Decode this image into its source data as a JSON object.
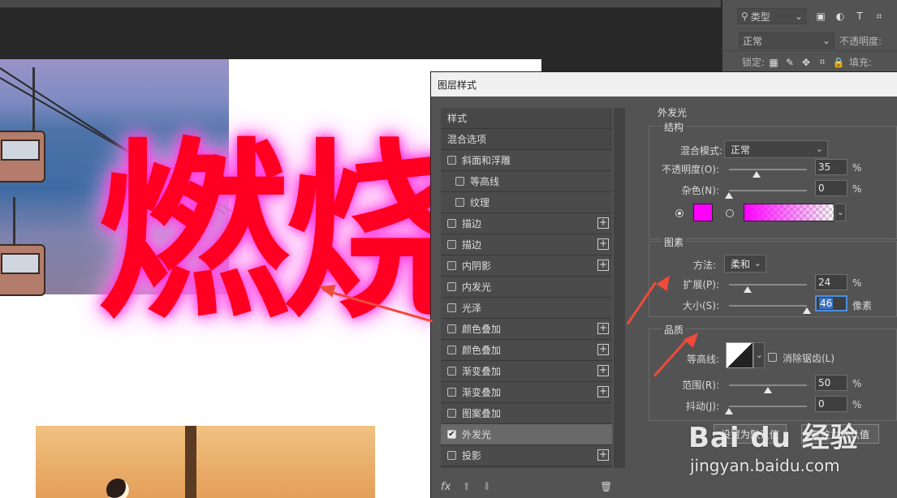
{
  "canvas": {
    "text_art": "燃烧"
  },
  "layers_panel": {
    "filter_label": "类型",
    "blend_mode": "正常",
    "opacity_label": "不透明度:",
    "lock_label": "锁定:",
    "fill_label": "填充:"
  },
  "dialog": {
    "title": "图层样式",
    "styles": [
      {
        "label": "样式",
        "type": "header"
      },
      {
        "label": "混合选项",
        "type": "header"
      },
      {
        "label": "斜面和浮雕",
        "checked": false,
        "plus": false,
        "indent": false
      },
      {
        "label": "等高线",
        "checked": false,
        "plus": false,
        "indent": true
      },
      {
        "label": "纹理",
        "checked": false,
        "plus": false,
        "indent": true
      },
      {
        "label": "描边",
        "checked": false,
        "plus": true,
        "indent": false
      },
      {
        "label": "描边",
        "checked": false,
        "plus": true,
        "indent": false
      },
      {
        "label": "内阴影",
        "checked": false,
        "plus": true,
        "indent": false
      },
      {
        "label": "内发光",
        "checked": false,
        "plus": false,
        "indent": false
      },
      {
        "label": "光泽",
        "checked": false,
        "plus": false,
        "indent": false
      },
      {
        "label": "颜色叠加",
        "checked": false,
        "plus": true,
        "indent": false
      },
      {
        "label": "颜色叠加",
        "checked": false,
        "plus": true,
        "indent": false
      },
      {
        "label": "渐变叠加",
        "checked": false,
        "plus": true,
        "indent": false
      },
      {
        "label": "渐变叠加",
        "checked": false,
        "plus": true,
        "indent": false
      },
      {
        "label": "图案叠加",
        "checked": false,
        "plus": false,
        "indent": false
      },
      {
        "label": "外发光",
        "checked": true,
        "plus": false,
        "indent": false,
        "selected": true
      },
      {
        "label": "投影",
        "checked": false,
        "plus": true,
        "indent": false
      }
    ],
    "footer": {
      "fx": "fx",
      "up": "⬆",
      "down": "⬇",
      "trash": "🗑"
    },
    "outer_glow": {
      "title": "外发光",
      "structure": {
        "title": "结构",
        "blend_mode_label": "混合模式:",
        "blend_mode_value": "正常",
        "opacity_label": "不透明度(O):",
        "opacity_value": "35",
        "noise_label": "杂色(N):",
        "noise_value": "0",
        "percent": "%",
        "glow_color": "#ff00ff",
        "solid_color_selected": true
      },
      "elements": {
        "title": "图素",
        "method_label": "方法:",
        "method_value": "柔和",
        "spread_label": "扩展(P):",
        "spread_value": "24",
        "size_label": "大小(S):",
        "size_value": "46",
        "percent": "%",
        "pixels": "像素"
      },
      "quality": {
        "title": "品质",
        "contour_label": "等高线:",
        "anti_alias_label": "消除锯齿(L)",
        "range_label": "范围(R):",
        "range_value": "50",
        "jitter_label": "抖动(J):",
        "jitter_value": "0",
        "percent": "%"
      },
      "set_default": "设置为默认值",
      "reset_default": "复位为默认值"
    }
  },
  "watermark": {
    "main": "Bai du 经验",
    "sub": "jingyan.baidu.com"
  },
  "colors": {
    "text_red": "#ff0022",
    "glow_magenta": "#ff00ff",
    "annotation_arrow": "#f04a3a"
  }
}
